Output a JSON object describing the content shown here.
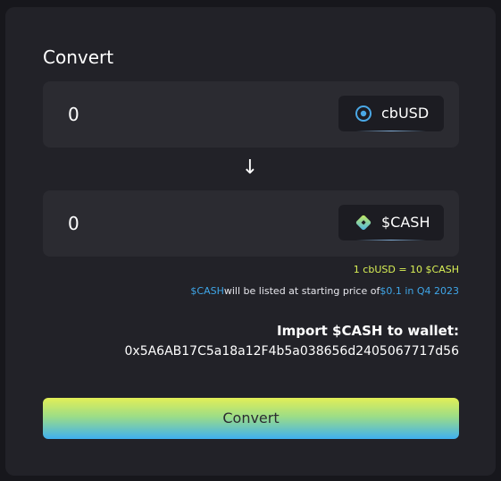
{
  "panel": {
    "title": "Convert"
  },
  "from": {
    "amount": "0",
    "token": "cbUSD",
    "token_icon": "cbusd-coin-icon"
  },
  "direction_icon": "arrow-down-icon",
  "to": {
    "amount": "0",
    "token": "$CASH",
    "token_icon": "cash-diamond-icon"
  },
  "info": {
    "rate": "1 cbUSD = 10 $CASH",
    "listing_token": "$CASH",
    "listing_text": "will be listed at starting price of",
    "listing_price": "$0.1 in Q4 2023"
  },
  "import": {
    "title": "Import $CASH to wallet:",
    "address": "0x5A6AB17C5a18a12F4b5a038656d2405067717d56"
  },
  "actions": {
    "convert_label": "Convert"
  },
  "colors": {
    "background": "#17171c",
    "card": "#222228",
    "field": "#2b2b31",
    "rate_text": "#d9f055",
    "highlight_blue": "#3fa6e8",
    "button_gradient_top": "#e3ef57",
    "button_gradient_bottom": "#3fb0f0"
  }
}
